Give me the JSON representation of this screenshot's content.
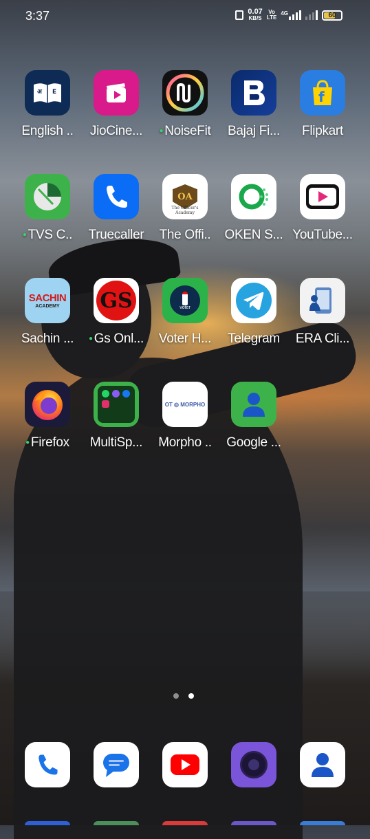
{
  "status_bar": {
    "time": "3:37",
    "net_speed": "0.07",
    "net_unit": "KB/S",
    "volte_top": "Vo",
    "volte_bottom": "LTE",
    "network_type": "4G",
    "battery": "60"
  },
  "rows": [
    [
      {
        "label": "English ..",
        "icon": "english-dictionary-icon",
        "dot": false
      },
      {
        "label": "JioCine...",
        "icon": "jiocinema-icon",
        "dot": false
      },
      {
        "label": "NoiseFit",
        "icon": "noisefit-icon",
        "dot": true
      },
      {
        "label": "Bajaj Fi...",
        "icon": "bajaj-finserv-icon",
        "dot": false
      },
      {
        "label": "Flipkart",
        "icon": "flipkart-icon",
        "dot": false
      }
    ],
    [
      {
        "label": "TVS C..",
        "icon": "tvs-connect-icon",
        "dot": true
      },
      {
        "label": "Truecaller",
        "icon": "truecaller-icon",
        "dot": false
      },
      {
        "label": "The Offi..",
        "icon": "officers-academy-icon",
        "dot": false
      },
      {
        "label": "OKEN S...",
        "icon": "oken-icon",
        "dot": false
      },
      {
        "label": "YouTube...",
        "icon": "youtube-create-icon",
        "dot": false
      }
    ],
    [
      {
        "label": "Sachin ...",
        "icon": "sachin-academy-icon",
        "dot": false
      },
      {
        "label": "Gs Onl...",
        "icon": "gs-online-icon",
        "dot": true
      },
      {
        "label": "Voter H...",
        "icon": "voter-helpline-icon",
        "dot": false
      },
      {
        "label": "Telegram",
        "icon": "telegram-icon",
        "dot": false
      },
      {
        "label": "ERA Cli...",
        "icon": "era-client-icon",
        "dot": false
      }
    ],
    [
      {
        "label": "Firefox",
        "icon": "firefox-icon",
        "dot": true
      },
      {
        "label": "MultiSp...",
        "icon": "multispace-folder-icon",
        "dot": false
      },
      {
        "label": "Morpho ..",
        "icon": "morpho-icon",
        "dot": false
      },
      {
        "label": "Google ...",
        "icon": "google-contacts-icon",
        "dot": false
      }
    ]
  ],
  "icon_text": {
    "english_a": "अ",
    "english_e": "E",
    "sachin_top": "SACHIN",
    "sachin_bottom": "ACADEMY",
    "gs": "GS",
    "morpho": "OT ◎ MORPHO",
    "voter": "voter",
    "officers": "OA",
    "officers_sub": "The Officer's Academy"
  },
  "dock": [
    {
      "icon": "phone-icon"
    },
    {
      "icon": "messages-icon"
    },
    {
      "icon": "youtube-icon"
    },
    {
      "icon": "camera-icon"
    },
    {
      "icon": "contacts-icon"
    }
  ],
  "page_indicator": {
    "count": 2,
    "active": 2
  },
  "colors": {
    "notification_dot": "#35d46a",
    "battery_fill": "#e8c34a"
  }
}
